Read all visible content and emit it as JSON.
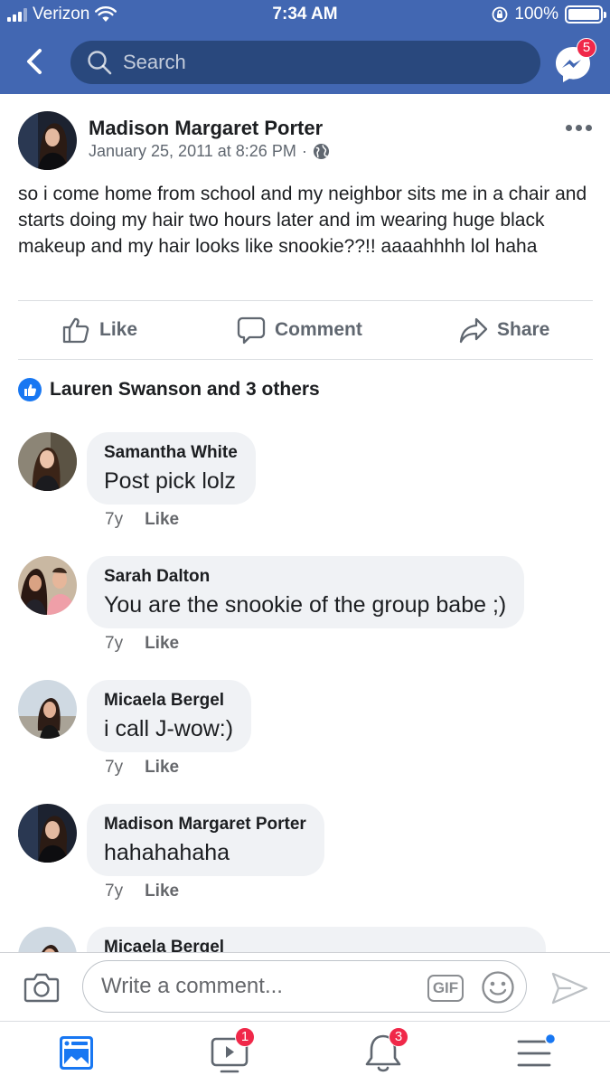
{
  "status_bar": {
    "carrier": "Verizon",
    "time": "7:34 AM",
    "battery": "100%"
  },
  "nav": {
    "search_placeholder": "Search",
    "messenger_badge": "5"
  },
  "post": {
    "author": "Madison Margaret Porter",
    "timestamp": "January 25, 2011 at 8:26 PM",
    "separator": "·",
    "text": "so i come home from school and my neighbor sits me in a chair and starts doing my hair two hours later and im wearing huge black makeup and my hair looks like snookie??!! aaaahhhh lol haha",
    "actions": {
      "like": "Like",
      "comment": "Comment",
      "share": "Share"
    },
    "reactions_summary": "Lauren Swanson and 3 others"
  },
  "comments": [
    {
      "name": "Samantha White",
      "text": "Post pick lolz",
      "age": "7y",
      "like": "Like"
    },
    {
      "name": "Sarah Dalton",
      "text": "You are the snookie of the group babe ;)",
      "age": "7y",
      "like": "Like"
    },
    {
      "name": "Micaela Bergel",
      "text": "i call J-wow:)",
      "age": "7y",
      "like": "Like"
    },
    {
      "name": "Madison Margaret Porter",
      "text": "hahahahaha",
      "age": "7y",
      "like": "Like"
    },
    {
      "name": "Micaela Bergel",
      "text": "",
      "age": "",
      "like": ""
    }
  ],
  "composer": {
    "placeholder": "Write a comment...",
    "gif_label": "GIF"
  },
  "tabbar": {
    "watch_badge": "1",
    "notifications_badge": "3"
  },
  "colors": {
    "header": "#4267b2",
    "search_bg": "#29487d",
    "like_blue": "#1877f2",
    "badge_red": "#f02849",
    "bubble": "#f0f2f5"
  },
  "icons": [
    "back-chevron-icon",
    "search-icon",
    "messenger-icon",
    "globe-icon",
    "more-icon",
    "thumbs-up-icon",
    "comment-icon",
    "share-icon",
    "camera-icon",
    "emoji-icon",
    "send-icon",
    "news-feed-icon",
    "watch-icon",
    "bell-icon",
    "menu-icon"
  ]
}
